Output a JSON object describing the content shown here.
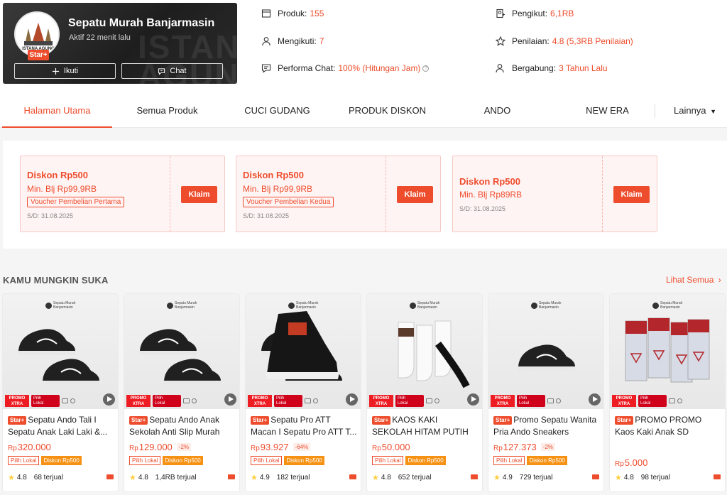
{
  "shop": {
    "name": "Sepatu Murah Banjarmasin",
    "active": "Aktif 22 menit lalu",
    "badge": "Star+",
    "logo_text": "ISTANA AGUNG",
    "follow_label": "Ikuti",
    "chat_label": "Chat"
  },
  "stats": {
    "produk": {
      "label": "Produk:",
      "value": "155"
    },
    "mengikuti": {
      "label": "Mengikuti:",
      "value": "7"
    },
    "performa": {
      "label": "Performa Chat:",
      "value": "100% (Hitungan Jam)"
    },
    "pengikut": {
      "label": "Pengikut:",
      "value": "6,1RB"
    },
    "penilaian": {
      "label": "Penilaian:",
      "value": "4.8 (5,3RB Penilaian)"
    },
    "bergabung": {
      "label": "Bergabung:",
      "value": "3 Tahun Lalu"
    }
  },
  "tabs": [
    {
      "label": "Halaman Utama",
      "active": true
    },
    {
      "label": "Semua Produk"
    },
    {
      "label": "CUCI GUDANG"
    },
    {
      "label": "PRODUK DISKON"
    },
    {
      "label": "ANDO"
    },
    {
      "label": "NEW ERA"
    },
    {
      "label": "Lainnya"
    }
  ],
  "vouchers": [
    {
      "title": "Diskon Rp500",
      "min": "Min. Blj Rp99,9RB",
      "tag": "Voucher Pembelian Pertama",
      "date": "S/D: 31.08.2025",
      "claim": "Klaim"
    },
    {
      "title": "Diskon Rp500",
      "min": "Min. Blj Rp99,9RB",
      "tag": "Voucher Pembelian Kedua",
      "date": "S/D: 31.08.2025",
      "claim": "Klaim"
    },
    {
      "title": "Diskon Rp500",
      "min": "Min. Blj Rp89RB",
      "tag": "",
      "date": "S/D: 31.08.2025",
      "claim": "Klaim"
    }
  ],
  "recommend": {
    "title": "KAMU MUNGKIN SUKA",
    "see_all": "Lihat Semua",
    "brand_line1": "Sepatu Murah",
    "brand_line2": "Banjarmasin",
    "products": [
      {
        "title": "Sepatu Ando Tali I Sepatu Anak Laki Laki &...",
        "currency": "Rp",
        "price": "320.000",
        "discount": "",
        "lokal": "Pilih Lokal",
        "diskon": "Diskon Rp500",
        "rating": "4.8",
        "sold": "68 terjual",
        "image": "shoe-black-lace"
      },
      {
        "title": "Sepatu Ando Anak Sekolah Anti Slip Murah",
        "currency": "Rp",
        "price": "129.000",
        "discount": "-2%",
        "lokal": "Pilih Lokal",
        "diskon": "Diskon Rp500",
        "rating": "4.8",
        "sold": "1,4RB terjual",
        "image": "shoe-black-velcro"
      },
      {
        "title": "Sepatu Pro ATT Macan I Sepatu Pro ATT T...",
        "currency": "Rp",
        "price": "93.927",
        "discount": "-64%",
        "lokal": "Pilih Lokal",
        "diskon": "Diskon Rp500",
        "rating": "4.9",
        "sold": "182 terjual",
        "image": "shoe-hightop-canvas"
      },
      {
        "title": "KAOS KAKI SEKOLAH HITAM PUTIH SD SMP SM...",
        "currency": "Rp",
        "price": "50.000",
        "discount": "",
        "lokal": "Pilih Lokal",
        "diskon": "Diskon Rp500",
        "rating": "4.8",
        "sold": "652 terjual",
        "image": "socks-white"
      },
      {
        "title": "Promo Sepatu Wanita Pria Ando Sneakers Hitam...",
        "currency": "Rp",
        "price": "127.373",
        "discount": "-2%",
        "lokal": "Pilih Lokal",
        "diskon": "Diskon Rp500",
        "rating": "4.9",
        "sold": "729 terjual",
        "image": "shoe-black-running"
      },
      {
        "title": "PROMO PROMO Kaos Kaki Anak SD MURAH...",
        "currency": "Rp",
        "price": "5.000",
        "discount": "",
        "lokal": "",
        "diskon": "",
        "rating": "4.8",
        "sold": "98 terjual",
        "image": "socks-pack"
      }
    ]
  },
  "labels": {
    "star_plus": "Star+",
    "promo_xtra_1": "PROMO",
    "promo_xtra_2": "XTRA",
    "pilih_lokal_1": "Pilih",
    "pilih_lokal_2": "Lokal"
  },
  "colors": {
    "accent": "#ee4d2d",
    "star": "#ffce3d",
    "diskon_badge": "#f69113"
  }
}
